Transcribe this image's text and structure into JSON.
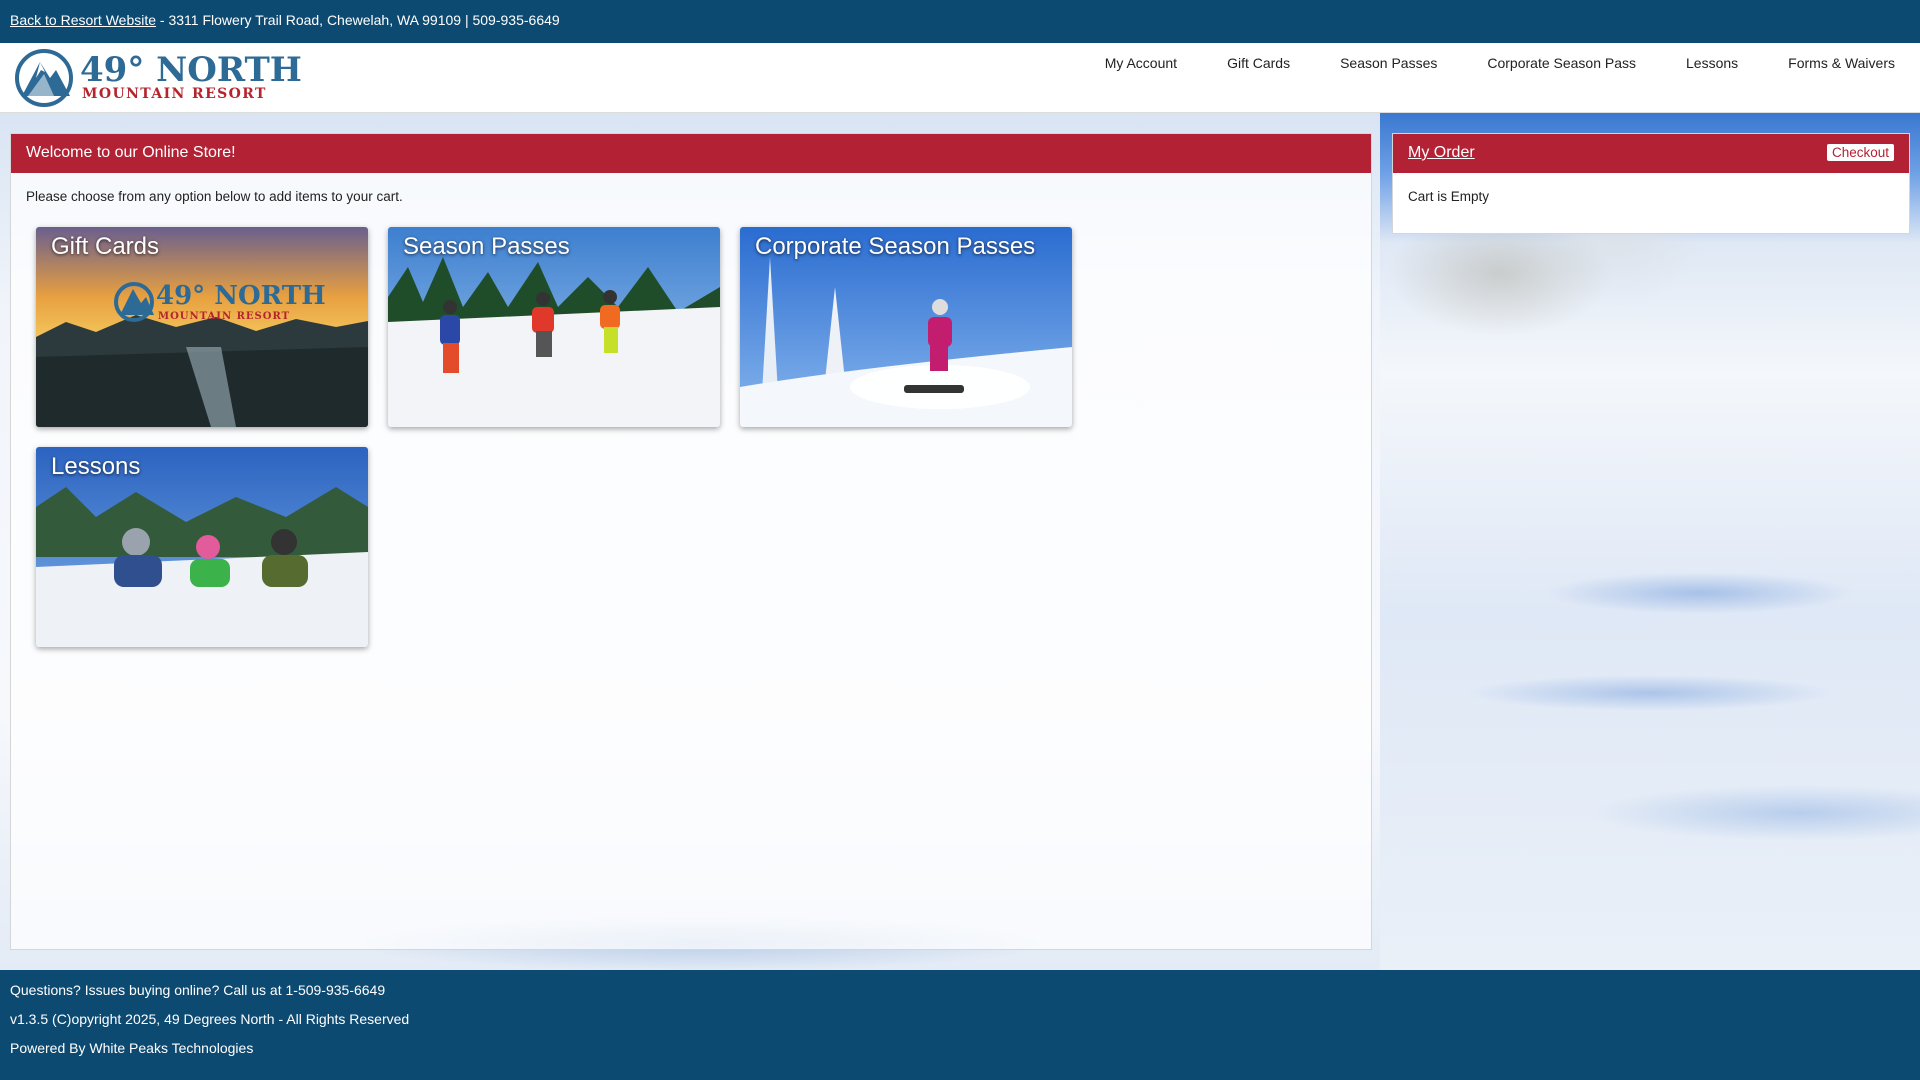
{
  "topbar": {
    "back_link": "Back to Resort Website",
    "address": "- 3311 Flowery Trail Road, Chewelah, WA 99109 | 509-935-6649"
  },
  "logo": {
    "line1": "49° NORTH",
    "line2": "MOUNTAIN RESORT"
  },
  "nav": {
    "items": [
      "My Account",
      "Gift Cards",
      "Season Passes",
      "Corporate Season Pass",
      "Lessons",
      "Forms & Waivers"
    ]
  },
  "main": {
    "header": "Welcome to our Online Store!",
    "intro": "Please choose from any option below to add items to your cart.",
    "tiles": [
      "Gift Cards",
      "Season Passes",
      "Corporate Season Passes",
      "Lessons"
    ],
    "gift_card_logo_line1": "49° NORTH",
    "gift_card_logo_line2": "MOUNTAIN RESORT"
  },
  "order": {
    "title": "My Order",
    "checkout": "Checkout",
    "empty": "Cart is Empty"
  },
  "footer": {
    "line1": "Questions? Issues buying online? Call us at 1-509-935-6649",
    "line2": "v1.3.5 (C)opyright 2025, 49 Degrees North - All Rights Reserved",
    "line3": "Powered By White Peaks Technologies"
  },
  "colors": {
    "brand_blue": "#0d4a72",
    "brand_red": "#b22234"
  }
}
